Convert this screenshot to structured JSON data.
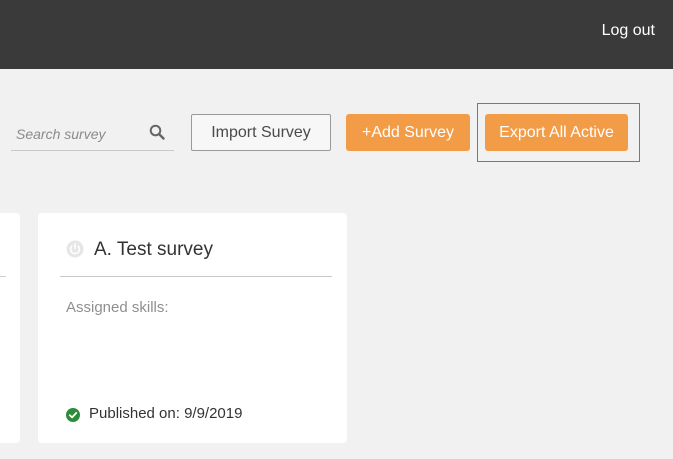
{
  "header": {
    "logout_label": "Log out"
  },
  "toolbar": {
    "search_placeholder": "Search survey",
    "import_label": "Import Survey",
    "add_label": "+Add Survey",
    "export_label": "Export All Active"
  },
  "survey_card": {
    "title": "A. Test survey",
    "assigned_skills_label": "Assigned skills:",
    "published_text": "Published on: 9/9/2019"
  },
  "colors": {
    "topbar": "#3a3a3a",
    "accent": "#f39c47",
    "highlight": "#e64b4b",
    "success": "#2e8b3a"
  },
  "icons": {
    "search": "search-icon",
    "power": "power-icon",
    "check": "check-circle-icon"
  }
}
